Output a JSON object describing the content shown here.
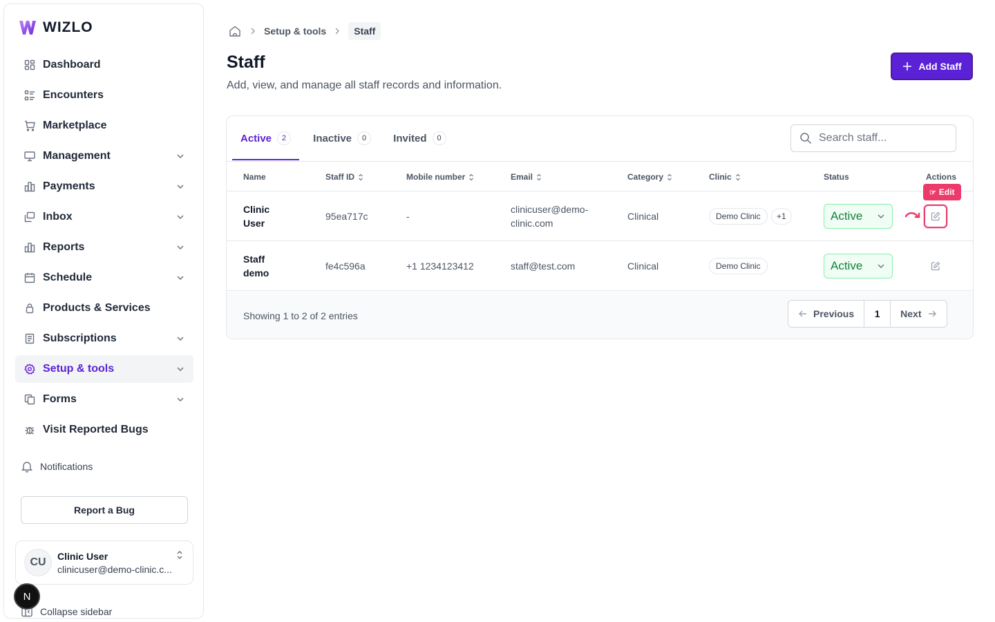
{
  "brand": {
    "name": "WIZLO",
    "accent": "#5b21d6"
  },
  "sidebar": {
    "items": [
      {
        "label": "Dashboard",
        "icon": "dashboard-grid-icon",
        "expandable": false
      },
      {
        "label": "Encounters",
        "icon": "list-icon",
        "expandable": false
      },
      {
        "label": "Marketplace",
        "icon": "cart-icon",
        "expandable": false
      },
      {
        "label": "Management",
        "icon": "monitor-icon",
        "expandable": true
      },
      {
        "label": "Payments",
        "icon": "bar-chart-icon",
        "expandable": true
      },
      {
        "label": "Inbox",
        "icon": "inbox-icon",
        "expandable": true
      },
      {
        "label": "Reports",
        "icon": "bar-chart-icon",
        "expandable": true
      },
      {
        "label": "Schedule",
        "icon": "calendar-icon",
        "expandable": true
      },
      {
        "label": "Products & Services",
        "icon": "lock-icon",
        "expandable": false
      },
      {
        "label": "Subscriptions",
        "icon": "receipt-icon",
        "expandable": true
      },
      {
        "label": "Setup & tools",
        "icon": "gear-icon",
        "expandable": true,
        "active": true
      },
      {
        "label": "Forms",
        "icon": "copy-icon",
        "expandable": true
      },
      {
        "label": "Visit Reported Bugs",
        "icon": "bug-icon",
        "expandable": false
      }
    ],
    "notifications_label": "Notifications",
    "report_bug_label": "Report a Bug",
    "user": {
      "initials": "CU",
      "name": "Clinic User",
      "email": "clinicuser@demo-clinic.c..."
    },
    "collapse_label": "Collapse sidebar",
    "n_badge": "N"
  },
  "breadcrumb": {
    "parent": "Setup & tools",
    "current": "Staff"
  },
  "header": {
    "title": "Staff",
    "subtitle": "Add, view, and manage all staff records and information.",
    "add_button": "Add Staff"
  },
  "tabs": [
    {
      "label": "Active",
      "count": "2",
      "active": true
    },
    {
      "label": "Inactive",
      "count": "0"
    },
    {
      "label": "Invited",
      "count": "0"
    }
  ],
  "search": {
    "placeholder": "Search staff..."
  },
  "table": {
    "columns": [
      "Name",
      "Staff ID",
      "Mobile number",
      "Email",
      "Category",
      "Clinic",
      "Status",
      "Actions"
    ],
    "rows": [
      {
        "name_line1": "Clinic",
        "name_line2": "User",
        "staff_id": "95ea717c",
        "mobile": "-",
        "email_line1": "clinicuser@demo-",
        "email_line2": "clinic.com",
        "category": "Clinical",
        "clinic": "Demo Clinic",
        "clinic_more": "+1",
        "status": "Active"
      },
      {
        "name_line1": "Staff",
        "name_line2": "demo",
        "staff_id": "fe4c596a",
        "mobile": "+1 1234123412",
        "email_line1": "staff@test.com",
        "email_line2": "",
        "category": "Clinical",
        "clinic": "Demo Clinic",
        "clinic_more": "",
        "status": "Active"
      }
    ],
    "edit_tooltip": "Edit",
    "entries_text": "Showing 1 to 2 of 2 entries",
    "pager": {
      "previous": "Previous",
      "page": "1",
      "next": "Next"
    }
  }
}
